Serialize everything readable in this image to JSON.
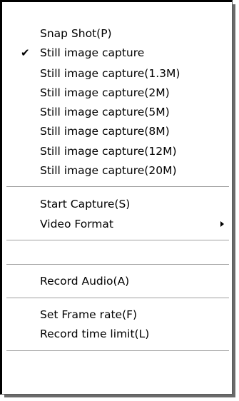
{
  "menu": {
    "items": [
      {
        "label": "Snap Shot(P)"
      },
      {
        "label": "Still image capture",
        "checked": true
      },
      {
        "label": "Still image capture(1.3M)"
      },
      {
        "label": "Still image capture(2M)"
      },
      {
        "label": "Still image capture(5M)"
      },
      {
        "label": "Still image capture(8M)"
      },
      {
        "label": "Still image capture(12M)"
      },
      {
        "label": "Still image capture(20M)"
      },
      {
        "label": "Start Capture(S)"
      },
      {
        "label": "Video Format",
        "submenu": true
      },
      {
        "label": ""
      },
      {
        "label": "Record Audio(A)"
      },
      {
        "label": "Set Frame rate(F)"
      },
      {
        "label": "Record time limit(L)"
      }
    ],
    "check_glyph": "✔",
    "icons": {
      "check": "checkmark-icon",
      "submenu": "submenu-arrow-icon"
    }
  }
}
